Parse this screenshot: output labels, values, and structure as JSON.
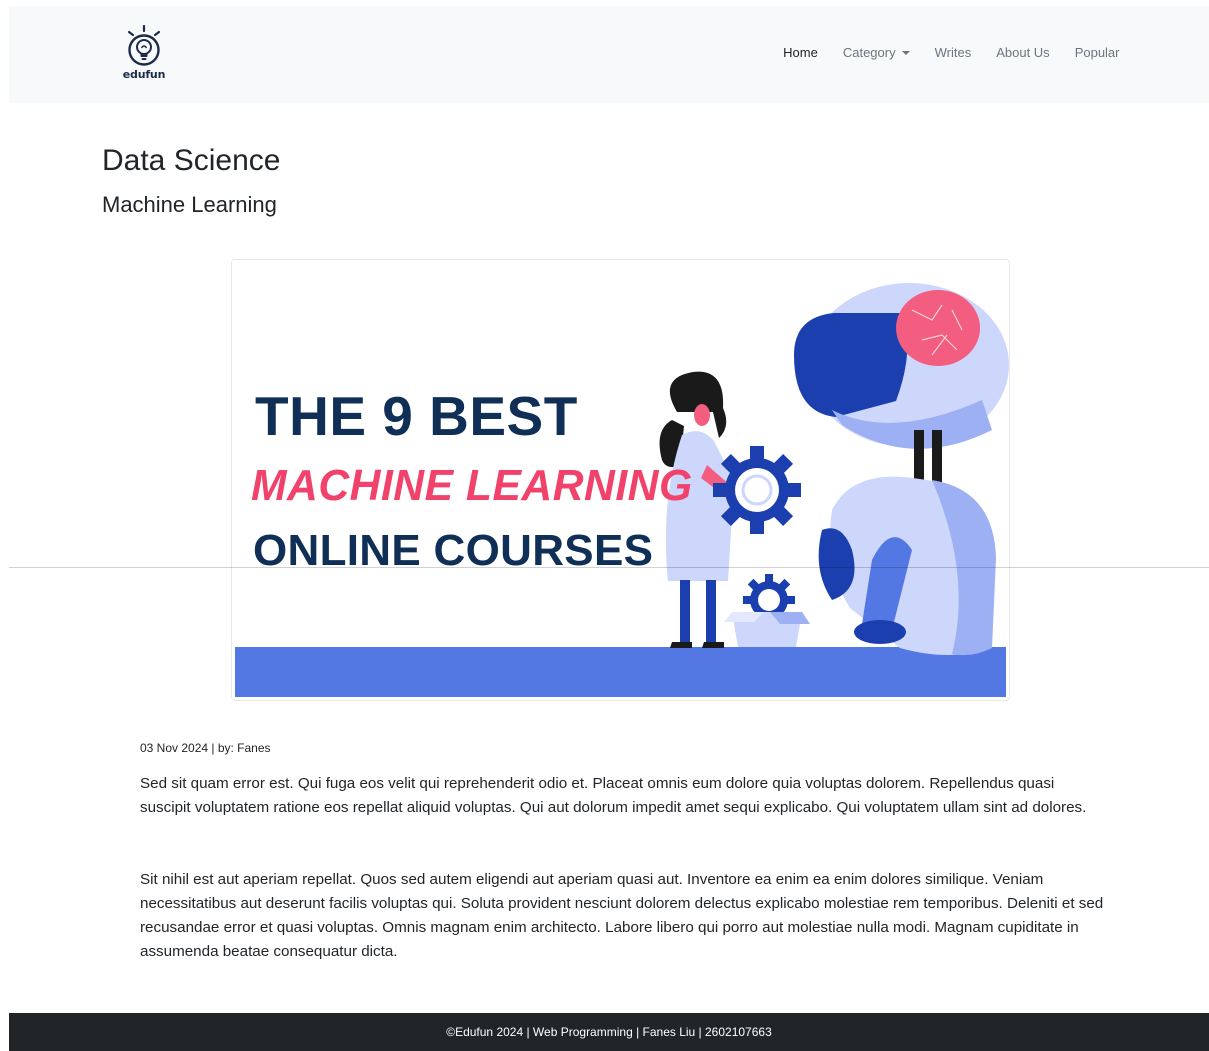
{
  "navbar": {
    "brand_name": "edufun",
    "links": [
      {
        "label": "Home",
        "active": true
      },
      {
        "label": "Category",
        "dropdown": true
      },
      {
        "label": "Writes"
      },
      {
        "label": "About Us"
      },
      {
        "label": "Popular"
      }
    ]
  },
  "article": {
    "title": "Data Science",
    "subtitle": "Machine Learning",
    "hero": {
      "line1": "THE 9 BEST",
      "line2": "MACHINE LEARNING",
      "line3": "ONLINE COURSES"
    },
    "meta": "03 Nov 2024 | by: Fanes",
    "paragraphs": [
      "Sed sit quam error est. Qui fuga eos velit qui reprehenderit odio et. Placeat omnis eum dolore quia voluptas dolorem. Repellendus quasi suscipit voluptatem ratione eos repellat aliquid voluptas. Qui aut dolorum impedit amet sequi explicabo. Qui voluptatem ullam sint ad dolores.",
      "Sit nihil est aut aperiam repellat. Quos sed autem eligendi aut aperiam quasi aut. Inventore ea enim ea enim dolores similique. Veniam necessitatibus aut deserunt facilis voluptas qui. Soluta provident nesciunt dolorem delectus explicabo molestiae rem temporibus. Deleniti et sed recusandae error et quasi voluptas. Omnis magnam enim architecto. Labore libero qui porro aut molestiae nulla modi. Magnam cupiditate in assumenda beatae consequatur dicta."
    ]
  },
  "footer": {
    "text": "©Edufun 2024 | Web Programming | Fanes Liu | 2602107663"
  },
  "colors": {
    "navbar_bg": "#f8f9fa",
    "footer_bg": "#212529",
    "hero_navy": "#102f56",
    "hero_pink": "#f0426a",
    "hero_blue": "#5478e3"
  }
}
